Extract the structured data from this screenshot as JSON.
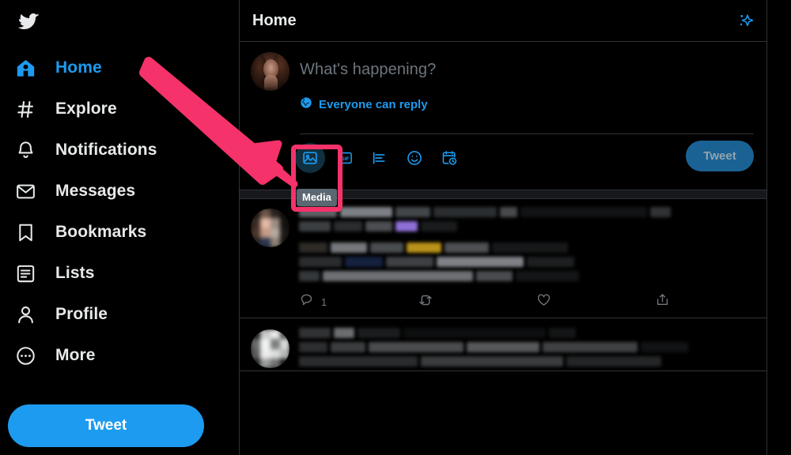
{
  "brand": {
    "logo_icon": "twitter-bird-icon",
    "accent": "#1d9bf0",
    "annotation_color": "#f5326a"
  },
  "sidebar": {
    "items": [
      {
        "label": "Home",
        "icon": "home-icon",
        "active": true
      },
      {
        "label": "Explore",
        "icon": "hashtag-icon",
        "active": false
      },
      {
        "label": "Notifications",
        "icon": "bell-icon",
        "active": false
      },
      {
        "label": "Messages",
        "icon": "envelope-icon",
        "active": false
      },
      {
        "label": "Bookmarks",
        "icon": "bookmark-icon",
        "active": false
      },
      {
        "label": "Lists",
        "icon": "list-icon",
        "active": false
      },
      {
        "label": "Profile",
        "icon": "person-icon",
        "active": false
      },
      {
        "label": "More",
        "icon": "more-circle-icon",
        "active": false
      }
    ],
    "tweet_button": "Tweet"
  },
  "header": {
    "title": "Home",
    "sparkle_icon": "sparkles-icon"
  },
  "compose": {
    "avatar_icon": "user-avatar",
    "placeholder": "What's happening?",
    "reply_setting": "Everyone can reply",
    "reply_setting_icon": "globe-icon",
    "tools": [
      {
        "name": "Media",
        "icon": "image-icon",
        "hovered": true
      },
      {
        "name": "GIF",
        "icon": "gif-icon",
        "hovered": false
      },
      {
        "name": "Poll",
        "icon": "poll-icon",
        "hovered": false
      },
      {
        "name": "Emoji",
        "icon": "emoji-icon",
        "hovered": false
      },
      {
        "name": "Schedule",
        "icon": "schedule-icon",
        "hovered": false
      }
    ],
    "tweet_button": "Tweet"
  },
  "annotation": {
    "tooltip_text": "Media",
    "arrow_icon": "pointer-arrow",
    "highlight_target": "media-button"
  },
  "feed": {
    "tweets": [
      {
        "content_state": "blurred",
        "actions": [
          {
            "name": "reply",
            "icon": "reply-icon",
            "count": "1"
          },
          {
            "name": "retweet",
            "icon": "retweet-icon",
            "count": ""
          },
          {
            "name": "like",
            "icon": "heart-icon",
            "count": ""
          },
          {
            "name": "share",
            "icon": "share-icon",
            "count": ""
          }
        ]
      },
      {
        "content_state": "blurred",
        "actions": []
      }
    ]
  }
}
